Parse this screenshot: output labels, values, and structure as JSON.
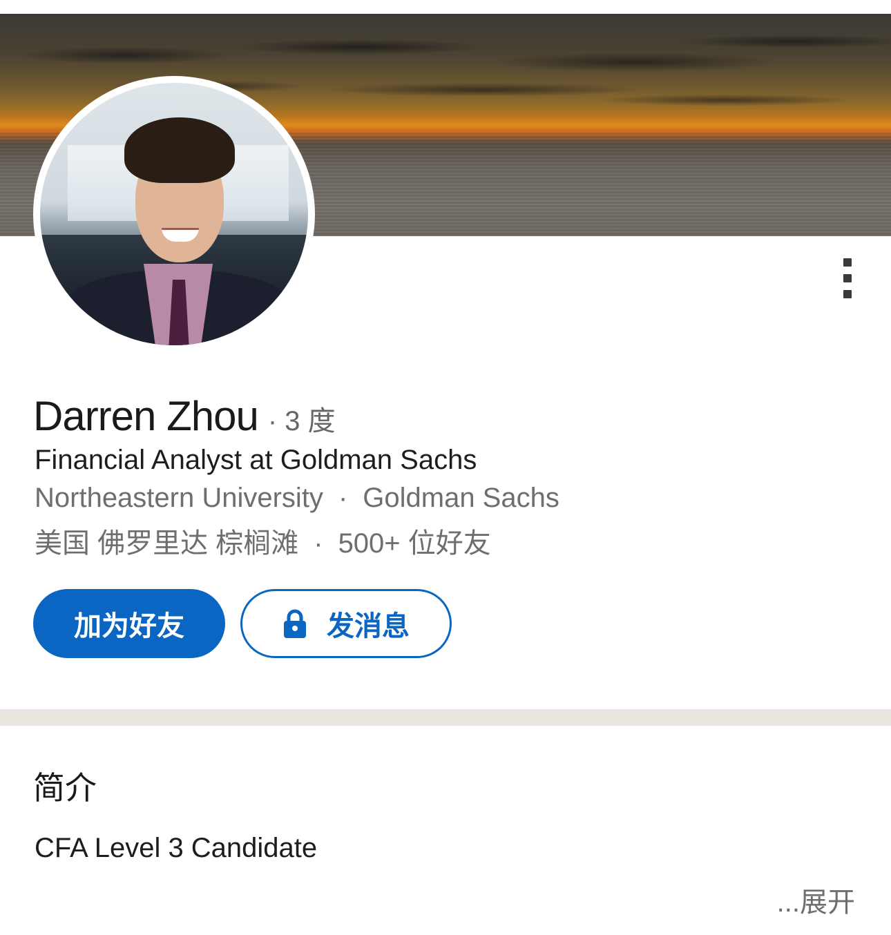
{
  "profile": {
    "name": "Darren Zhou",
    "degree_separator": "·",
    "degree": "3 度",
    "headline": "Financial Analyst at Goldman Sachs",
    "education": "Northeastern University",
    "company": "Goldman Sachs",
    "location": "美国 佛罗里达 棕榈滩",
    "connections": "500+ 位好友",
    "separator": "·"
  },
  "actions": {
    "connect_label": "加为好友",
    "message_label": "发消息",
    "message_icon": "lock-icon",
    "more_icon": "more-vertical-icon"
  },
  "about": {
    "title": "简介",
    "text": "CFA Level 3 Candidate",
    "expand_label": "...展开"
  },
  "colors": {
    "accent": "#0a66c2",
    "divider": "#e9e5df"
  }
}
